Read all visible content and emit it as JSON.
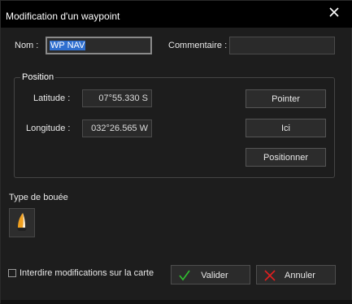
{
  "window": {
    "title": "Modification d'un waypoint",
    "close_symbol": "✕"
  },
  "form": {
    "name_label": "Nom :",
    "name_value": "WP NAV",
    "comment_label": "Commentaire :",
    "comment_value": ""
  },
  "position": {
    "group_title": "Position",
    "latitude_label": "Latitude :",
    "latitude_value": "07°55.330 S",
    "longitude_label": "Longitude :",
    "longitude_value": "032°26.565 W",
    "buttons": {
      "pointer": "Pointer",
      "here": "Ici",
      "position": "Positionner"
    }
  },
  "buoy": {
    "label": "Type de bouée",
    "icon": "yellow-buoy-icon",
    "color": "#f0a020"
  },
  "footer": {
    "lock_label": "Interdire modifications sur la carte",
    "lock_checked": false,
    "validate_label": "Valider",
    "validate_icon": "check-icon",
    "validate_color": "#30c030",
    "cancel_label": "Annuler",
    "cancel_icon": "cross-icon",
    "cancel_color": "#e02020"
  }
}
